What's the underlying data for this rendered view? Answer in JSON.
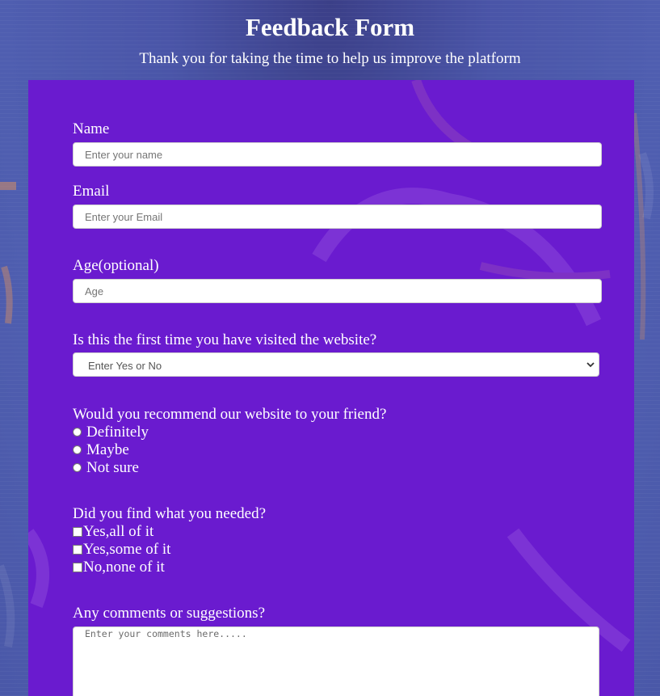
{
  "header": {
    "title": "Feedback Form",
    "subtitle": "Thank you for taking the time to help us improve the platform"
  },
  "form": {
    "name": {
      "label": "Name",
      "placeholder": "Enter your name",
      "value": ""
    },
    "email": {
      "label": "Email",
      "placeholder": "Enter your Email",
      "value": ""
    },
    "age": {
      "label": "Age(optional)",
      "placeholder": "Age",
      "value": ""
    },
    "first_visit": {
      "label": "Is this the first time you have visited the website?",
      "selected": "Enter Yes or No"
    },
    "recommend": {
      "label": "Would you recommend our website to your friend?",
      "options": [
        "Definitely",
        "Maybe",
        "Not sure"
      ]
    },
    "found_needed": {
      "label": "Did you find what you needed?",
      "options": [
        "Yes,all of it",
        "Yes,some of it",
        "No,none of it"
      ]
    },
    "comments": {
      "label": "Any comments or suggestions?",
      "placeholder": "Enter your comments here....."
    }
  },
  "colors": {
    "card_background": "#6a1bcf",
    "page_background": "#4f5eb0",
    "text": "#ffffff"
  },
  "icons": {
    "select_chevron": "chevron-down-icon"
  }
}
